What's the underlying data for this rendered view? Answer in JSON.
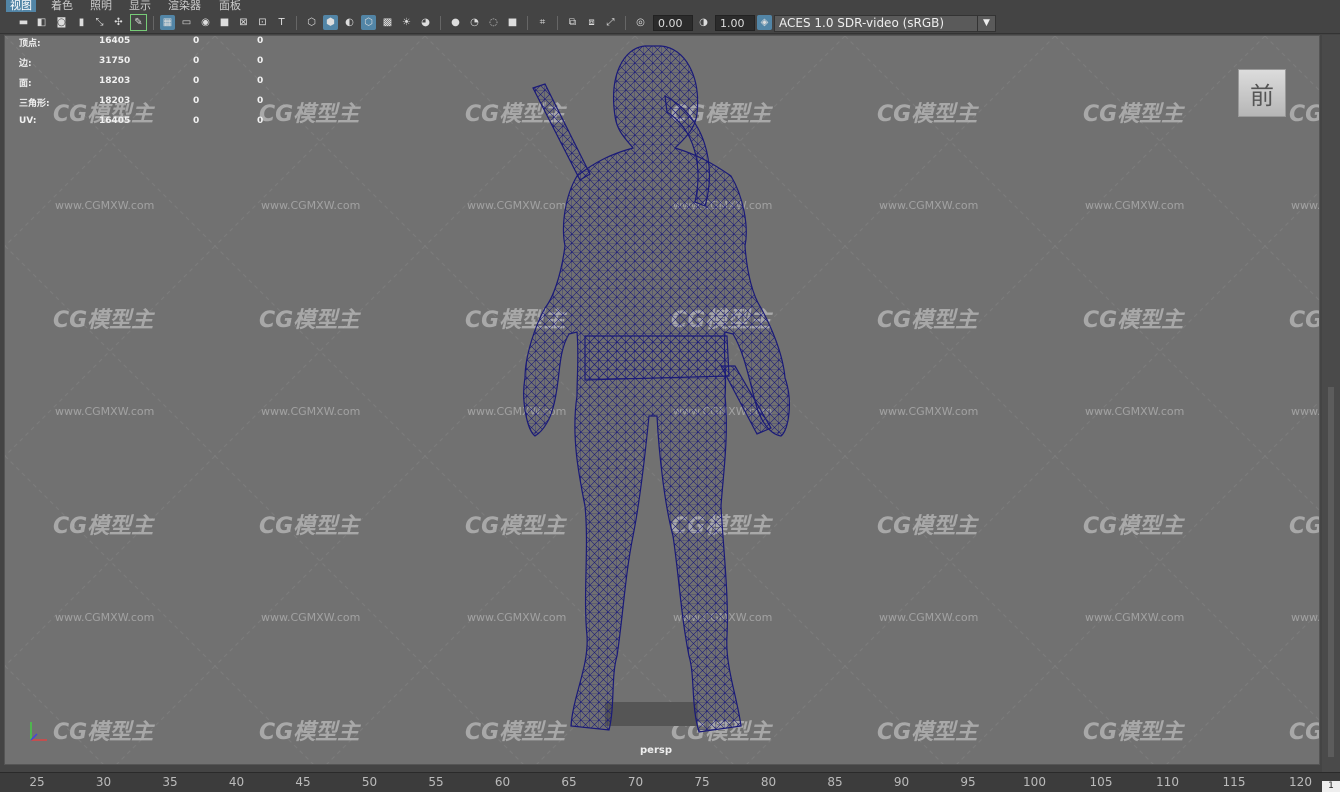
{
  "menu": [
    "视图",
    "着色",
    "照明",
    "显示",
    "渲染器",
    "面板"
  ],
  "toolbar": {
    "exposure": "0.00",
    "gamma": "1.00",
    "color_space": "ACES 1.0 SDR-video (sRGB)"
  },
  "hud": {
    "rows": [
      {
        "label": "顶点:",
        "v1": "16405",
        "v2": "0",
        "v3": "0"
      },
      {
        "label": "边:",
        "v1": "31750",
        "v2": "0",
        "v3": "0"
      },
      {
        "label": "面:",
        "v1": "18203",
        "v2": "0",
        "v3": "0"
      },
      {
        "label": "三角形:",
        "v1": "18203",
        "v2": "0",
        "v3": "0"
      },
      {
        "label": "UV:",
        "v1": "16405",
        "v2": "0",
        "v3": "0"
      }
    ]
  },
  "viewcube_label": "前",
  "camera_label": "persp",
  "watermark": {
    "logo": "CG模型主",
    "url": "www.CGMXW.com"
  },
  "timeline": {
    "ticks": [
      "25",
      "30",
      "35",
      "40",
      "45",
      "50",
      "55",
      "60",
      "65",
      "70",
      "75",
      "80",
      "85",
      "90",
      "95",
      "100",
      "105",
      "110",
      "115",
      "120"
    ],
    "current_frame": "1"
  },
  "colors": {
    "wireframe": "#1a1a78",
    "viewport_bg": "#717171",
    "accent": "#5285a6"
  }
}
